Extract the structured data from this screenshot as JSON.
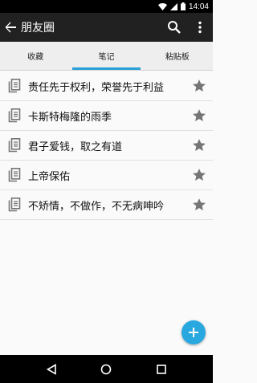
{
  "status_bar": {
    "time": "14:04",
    "icons": [
      "wifi-icon",
      "signal-icon",
      "battery-icon"
    ]
  },
  "app_bar": {
    "title": "朋友圈",
    "back_icon": "arrow-back-icon",
    "search_icon": "search-icon",
    "overflow_icon": "more-vert-icon"
  },
  "tabs": [
    {
      "label": "收藏",
      "active": false
    },
    {
      "label": "笔记",
      "active": true
    },
    {
      "label": "粘贴板",
      "active": false
    }
  ],
  "notes": [
    {
      "text": "责任先于权利，荣誉先于利益",
      "starred": true
    },
    {
      "text": "卡斯特梅隆的雨季",
      "starred": true
    },
    {
      "text": "君子爱钱，取之有道",
      "starred": true
    },
    {
      "text": "上帝保佑",
      "starred": true
    },
    {
      "text": "不矫情，不做作，不无病呻吟",
      "starred": true
    }
  ],
  "fab": {
    "icon": "add-icon"
  },
  "nav_bar": {
    "icons": [
      "nav-back-icon",
      "nav-home-icon",
      "nav-recents-icon"
    ]
  },
  "colors": {
    "app_bar": "#212121",
    "tab_bar": "#eeeeee",
    "tab_indicator": "#2a9fd6",
    "fab": "#29a8e0",
    "star": "#757575"
  }
}
